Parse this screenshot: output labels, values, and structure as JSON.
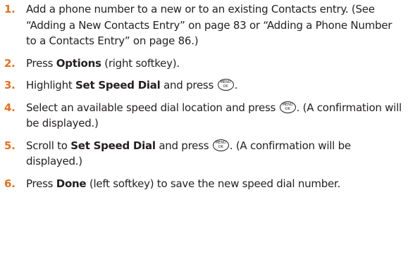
{
  "steps": [
    {
      "number": "1.",
      "text": "Add a phone number to a new or to an existing Contacts entry. (See “Adding a New Contacts Entry” on page 83 or “Adding a Phone Number to a Contacts Entry” on page 86.)"
    },
    {
      "number": "2.",
      "pre": "Press ",
      "bold": "Options",
      "post": " (right softkey)."
    },
    {
      "number": "3.",
      "pre": "Highlight ",
      "bold": "Set Speed Dial",
      "mid": " and press ",
      "icon": "menu-ok-key-icon",
      "post": "."
    },
    {
      "number": "4.",
      "pre": "Select an available speed dial location and press ",
      "icon": "menu-ok-key-icon",
      "post": ". (A confirmation will be displayed.)"
    },
    {
      "number": "5.",
      "pre": "Scroll to ",
      "bold": "Set Speed Dial",
      "mid": " and press ",
      "icon": "menu-ok-key-icon",
      "post": ". (A confirmation will be displayed.)"
    },
    {
      "number": "6.",
      "pre": "Press ",
      "bold": "Done",
      "post": " (left softkey) to save the new speed dial number."
    }
  ],
  "colors": {
    "step_number": "#e8701a",
    "text": "#231f20"
  }
}
